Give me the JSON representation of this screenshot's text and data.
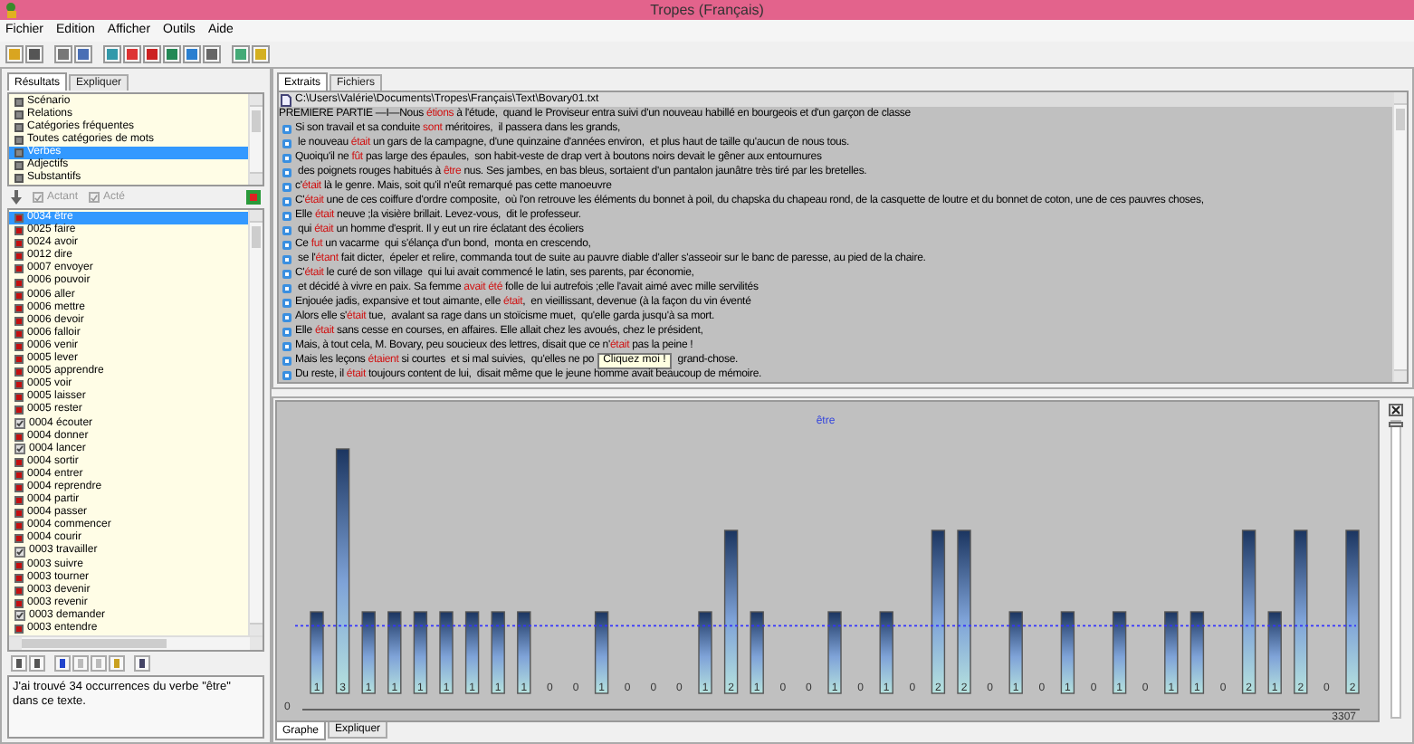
{
  "window": {
    "title": "Tropes (Français)"
  },
  "menu": [
    "Fichier",
    "Edition",
    "Afficher",
    "Outils",
    "Aide"
  ],
  "left_panel": {
    "tabs": [
      {
        "label": "Résultats",
        "selected": true
      },
      {
        "label": "Expliquer",
        "selected": false
      }
    ],
    "categories": [
      {
        "label": "Scénario",
        "selected": false
      },
      {
        "label": "Relations",
        "selected": false
      },
      {
        "label": "Catégories fréquentes",
        "selected": false
      },
      {
        "label": "Toutes catégories de mots",
        "selected": false
      },
      {
        "label": "Verbes",
        "selected": true
      },
      {
        "label": "Adjectifs",
        "selected": false
      },
      {
        "label": "Substantifs",
        "selected": false
      }
    ],
    "filters": [
      {
        "label": "Actant",
        "checked": true,
        "disabled": true
      },
      {
        "label": "Acté",
        "checked": true,
        "disabled": true
      }
    ],
    "words": [
      {
        "label": "0034 être",
        "kind": "flag",
        "selected": true
      },
      {
        "label": "0025 faire",
        "kind": "flag",
        "selected": false
      },
      {
        "label": "0024 avoir",
        "kind": "flag",
        "selected": false
      },
      {
        "label": "0012 dire",
        "kind": "flag",
        "selected": false
      },
      {
        "label": "0007 envoyer",
        "kind": "flag",
        "selected": false
      },
      {
        "label": "0006 pouvoir",
        "kind": "flag",
        "selected": false
      },
      {
        "label": "0006 aller",
        "kind": "flag",
        "selected": false
      },
      {
        "label": "0006 mettre",
        "kind": "flag",
        "selected": false
      },
      {
        "label": "0006 devoir",
        "kind": "flag",
        "selected": false
      },
      {
        "label": "0006 falloir",
        "kind": "flag",
        "selected": false
      },
      {
        "label": "0006 venir",
        "kind": "flag",
        "selected": false
      },
      {
        "label": "0005 lever",
        "kind": "flag",
        "selected": false
      },
      {
        "label": "0005 apprendre",
        "kind": "flag",
        "selected": false
      },
      {
        "label": "0005 voir",
        "kind": "flag",
        "selected": false
      },
      {
        "label": "0005 laisser",
        "kind": "flag",
        "selected": false
      },
      {
        "label": "0005 rester",
        "kind": "flag",
        "selected": false
      },
      {
        "label": "0004 écouter",
        "kind": "tick",
        "selected": false
      },
      {
        "label": "0004 donner",
        "kind": "flag",
        "selected": false
      },
      {
        "label": "0004 lancer",
        "kind": "tick",
        "selected": false
      },
      {
        "label": "0004 sortir",
        "kind": "flag",
        "selected": false
      },
      {
        "label": "0004 entrer",
        "kind": "flag",
        "selected": false
      },
      {
        "label": "0004 reprendre",
        "kind": "flag",
        "selected": false
      },
      {
        "label": "0004 partir",
        "kind": "flag",
        "selected": false
      },
      {
        "label": "0004 passer",
        "kind": "flag",
        "selected": false
      },
      {
        "label": "0004 commencer",
        "kind": "flag",
        "selected": false
      },
      {
        "label": "0004 courir",
        "kind": "flag",
        "selected": false
      },
      {
        "label": "0003 travailler",
        "kind": "tick",
        "selected": false
      },
      {
        "label": "0003 suivre",
        "kind": "flag",
        "selected": false
      },
      {
        "label": "0003 tourner",
        "kind": "flag",
        "selected": false
      },
      {
        "label": "0003 devenir",
        "kind": "flag",
        "selected": false
      },
      {
        "label": "0003 revenir",
        "kind": "flag",
        "selected": false
      },
      {
        "label": "0003 demander",
        "kind": "tick",
        "selected": false
      },
      {
        "label": "0003 entendre",
        "kind": "flag",
        "selected": false
      }
    ],
    "message": "J'ai trouvé 34 occurrences du verbe \"être\" dans ce texte."
  },
  "extracts_panel": {
    "tabs": [
      {
        "label": "Extraits",
        "selected": true
      },
      {
        "label": "Fichiers",
        "selected": false
      }
    ],
    "file_path": "C:\\Users\\Valérie\\Documents\\Tropes\\Français\\Text\\Bovary01.txt",
    "lines": [
      {
        "bullet": false,
        "segments": [
          {
            "kind": "text",
            "text": "PREMIERE PARTIE —I—Nous "
          },
          {
            "kind": "verb",
            "text": "étions"
          },
          {
            "kind": "text",
            "text": " à l'étude,  quand le Proviseur entra suivi d'un nouveau habillé en bourgeois et d'un garçon de classe"
          }
        ]
      },
      {
        "bullet": true,
        "segments": [
          {
            "kind": "text",
            "text": "Si son travail et sa conduite "
          },
          {
            "kind": "verb",
            "text": "sont"
          },
          {
            "kind": "text",
            "text": " méritoires,  il passera dans les grands,"
          }
        ]
      },
      {
        "bullet": true,
        "segments": [
          {
            "kind": "text",
            "text": " le nouveau "
          },
          {
            "kind": "verb",
            "text": "était"
          },
          {
            "kind": "text",
            "text": " un gars de la campagne, d'une quinzaine d'années environ,  et plus haut de taille qu'aucun de nous tous."
          }
        ]
      },
      {
        "bullet": true,
        "segments": [
          {
            "kind": "text",
            "text": "Quoiqu'il ne "
          },
          {
            "kind": "verb",
            "text": "fût"
          },
          {
            "kind": "text",
            "text": " pas large des épaules,  son habit-veste de drap vert à boutons noirs devait le gêner aux entournures"
          }
        ]
      },
      {
        "bullet": true,
        "segments": [
          {
            "kind": "text",
            "text": " des poignets rouges habitués à "
          },
          {
            "kind": "verb",
            "text": "être"
          },
          {
            "kind": "text",
            "text": " nus. Ses jambes, en bas bleus, sortaient d'un pantalon jaunâtre très tiré par les bretelles."
          }
        ]
      },
      {
        "bullet": true,
        "segments": [
          {
            "kind": "text",
            "text": "c'"
          },
          {
            "kind": "verb",
            "text": "était"
          },
          {
            "kind": "text",
            "text": " là le genre. Mais, soit qu'il n'eût remarqué pas cette manoeuvre"
          }
        ]
      },
      {
        "bullet": true,
        "segments": [
          {
            "kind": "text",
            "text": "C'"
          },
          {
            "kind": "verb",
            "text": "était"
          },
          {
            "kind": "text",
            "text": " une de ces coiffure d'ordre composite,  où l'on retrouve les éléments du bonnet à poil, du chapska du chapeau rond, de la casquette de loutre et du bonnet de coton, une de ces pauvres choses,"
          }
        ]
      },
      {
        "bullet": true,
        "segments": [
          {
            "kind": "text",
            "text": "Elle "
          },
          {
            "kind": "verb",
            "text": "était"
          },
          {
            "kind": "text",
            "text": " neuve ;la visière brillait. Levez-vous,  dit le professeur."
          }
        ]
      },
      {
        "bullet": true,
        "segments": [
          {
            "kind": "text",
            "text": " qui "
          },
          {
            "kind": "verb",
            "text": "était"
          },
          {
            "kind": "text",
            "text": " un homme d'esprit. Il y eut un rire éclatant des écoliers"
          }
        ]
      },
      {
        "bullet": true,
        "segments": [
          {
            "kind": "text",
            "text": "Ce "
          },
          {
            "kind": "verb",
            "text": "fut"
          },
          {
            "kind": "text",
            "text": " un vacarme  qui s'élança d'un bond,  monta en crescendo,"
          }
        ]
      },
      {
        "bullet": true,
        "segments": [
          {
            "kind": "text",
            "text": " se l'"
          },
          {
            "kind": "verb",
            "text": "étant"
          },
          {
            "kind": "text",
            "text": " fait dicter,  épeler et relire, commanda tout de suite au pauvre diable d'aller s'asseoir sur le banc de paresse, au pied de la chaire."
          }
        ]
      },
      {
        "bullet": true,
        "segments": [
          {
            "kind": "text",
            "text": "C'"
          },
          {
            "kind": "verb",
            "text": "était"
          },
          {
            "kind": "text",
            "text": " le curé de son village  qui lui avait commencé le latin, ses parents, par économie,"
          }
        ]
      },
      {
        "bullet": true,
        "segments": [
          {
            "kind": "text",
            "text": " et décidé à vivre en paix. Sa femme "
          },
          {
            "kind": "verb",
            "text": "avait été"
          },
          {
            "kind": "text",
            "text": " folle de lui autrefois ;elle l'avait aimé avec mille servilités"
          }
        ]
      },
      {
        "bullet": true,
        "segments": [
          {
            "kind": "text",
            "text": "Enjouée jadis, expansive et tout aimante, elle "
          },
          {
            "kind": "verb",
            "text": "était"
          },
          {
            "kind": "text",
            "text": ",  en vieillissant, devenue (à la façon du vin éventé"
          }
        ]
      },
      {
        "bullet": true,
        "segments": [
          {
            "kind": "text",
            "text": "Alors elle s'"
          },
          {
            "kind": "verb",
            "text": "était"
          },
          {
            "kind": "text",
            "text": " tue,  avalant sa rage dans un stoïcisme muet,  qu'elle garda jusqu'à sa mort."
          }
        ]
      },
      {
        "bullet": true,
        "segments": [
          {
            "kind": "text",
            "text": "Elle "
          },
          {
            "kind": "verb",
            "text": "était"
          },
          {
            "kind": "text",
            "text": " sans cesse en courses, en affaires. Elle allait chez les avoués, chez le président,"
          }
        ]
      },
      {
        "bullet": true,
        "segments": [
          {
            "kind": "text",
            "text": "Mais, à tout cela, M. Bovary, peu soucieux des lettres, disait que ce n'"
          },
          {
            "kind": "verb",
            "text": "était"
          },
          {
            "kind": "text",
            "text": " pas la peine !"
          }
        ]
      },
      {
        "bullet": true,
        "segments": [
          {
            "kind": "text",
            "text": "Mais les leçons "
          },
          {
            "kind": "verb",
            "text": "étaient"
          },
          {
            "kind": "text",
            "text": " si courtes  et si mal suivies,  qu'elles ne po"
          },
          {
            "kind": "tooltip",
            "text": "Cliquez moi !"
          },
          {
            "kind": "text",
            "text": " grand-chose."
          }
        ]
      },
      {
        "bullet": true,
        "segments": [
          {
            "kind": "text",
            "text": "Du reste, il "
          },
          {
            "kind": "verb",
            "text": "était"
          },
          {
            "kind": "text",
            "text": " toujours content de lui,  disait même que le jeune homme avait beaucoup de mémoire."
          }
        ]
      }
    ]
  },
  "graph_panel": {
    "tabs": [
      {
        "label": "Graphe",
        "selected": true
      },
      {
        "label": "Expliquer",
        "selected": false
      }
    ],
    "zoom_slider": {
      "level": 1
    },
    "axis_labels": [
      "0",
      "3307"
    ],
    "legend": "être",
    "bar_labels": [
      "1",
      "3",
      "1",
      "1",
      "1",
      "1",
      "1",
      "1",
      "1",
      "0",
      "0",
      "1",
      "0",
      "0",
      "0",
      "1",
      "2",
      "1",
      "0",
      "0",
      "1",
      "0",
      "1",
      "0",
      "2",
      "2",
      "0",
      "1",
      "0",
      "1",
      "0",
      "1",
      "0",
      "1",
      "1",
      "0",
      "2",
      "1",
      "2",
      "0",
      "2"
    ]
  }
}
